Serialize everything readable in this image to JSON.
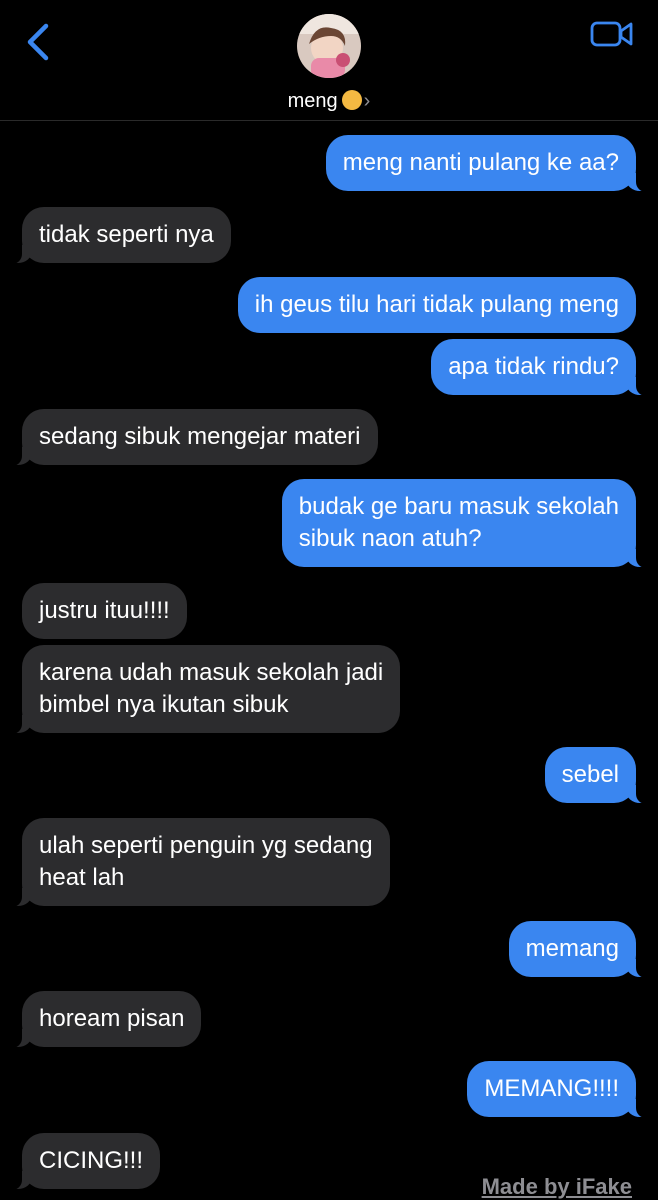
{
  "header": {
    "contact_name": "meng",
    "contact_emoji": "cat-face-icon",
    "back_icon": "chevron-left-icon",
    "video_icon": "video-camera-icon",
    "accent": "#3a86f0"
  },
  "messages": [
    {
      "side": "out",
      "text": "meng nanti pulang ke aa?"
    },
    {
      "side": "in",
      "text": "tidak seperti nya"
    },
    {
      "side": "out",
      "text": "ih geus tilu hari tidak pulang meng"
    },
    {
      "side": "out",
      "text": "apa tidak rindu?"
    },
    {
      "side": "in",
      "text": "sedang sibuk mengejar materi"
    },
    {
      "side": "out",
      "text": "budak ge baru masuk sekolah\nsibuk naon atuh?"
    },
    {
      "side": "in",
      "text": "justru ituu!!!!"
    },
    {
      "side": "in",
      "text": "karena udah masuk sekolah jadi\nbimbel nya ikutan sibuk"
    },
    {
      "side": "out",
      "text": "sebel"
    },
    {
      "side": "in",
      "text": "ulah seperti penguin yg sedang\nheat lah"
    },
    {
      "side": "out",
      "text": "memang"
    },
    {
      "side": "in",
      "text": "hoream pisan"
    },
    {
      "side": "out",
      "text": "MEMANG!!!!"
    },
    {
      "side": "in",
      "text": "CICING!!!"
    }
  ],
  "watermark": "Made by iFake"
}
